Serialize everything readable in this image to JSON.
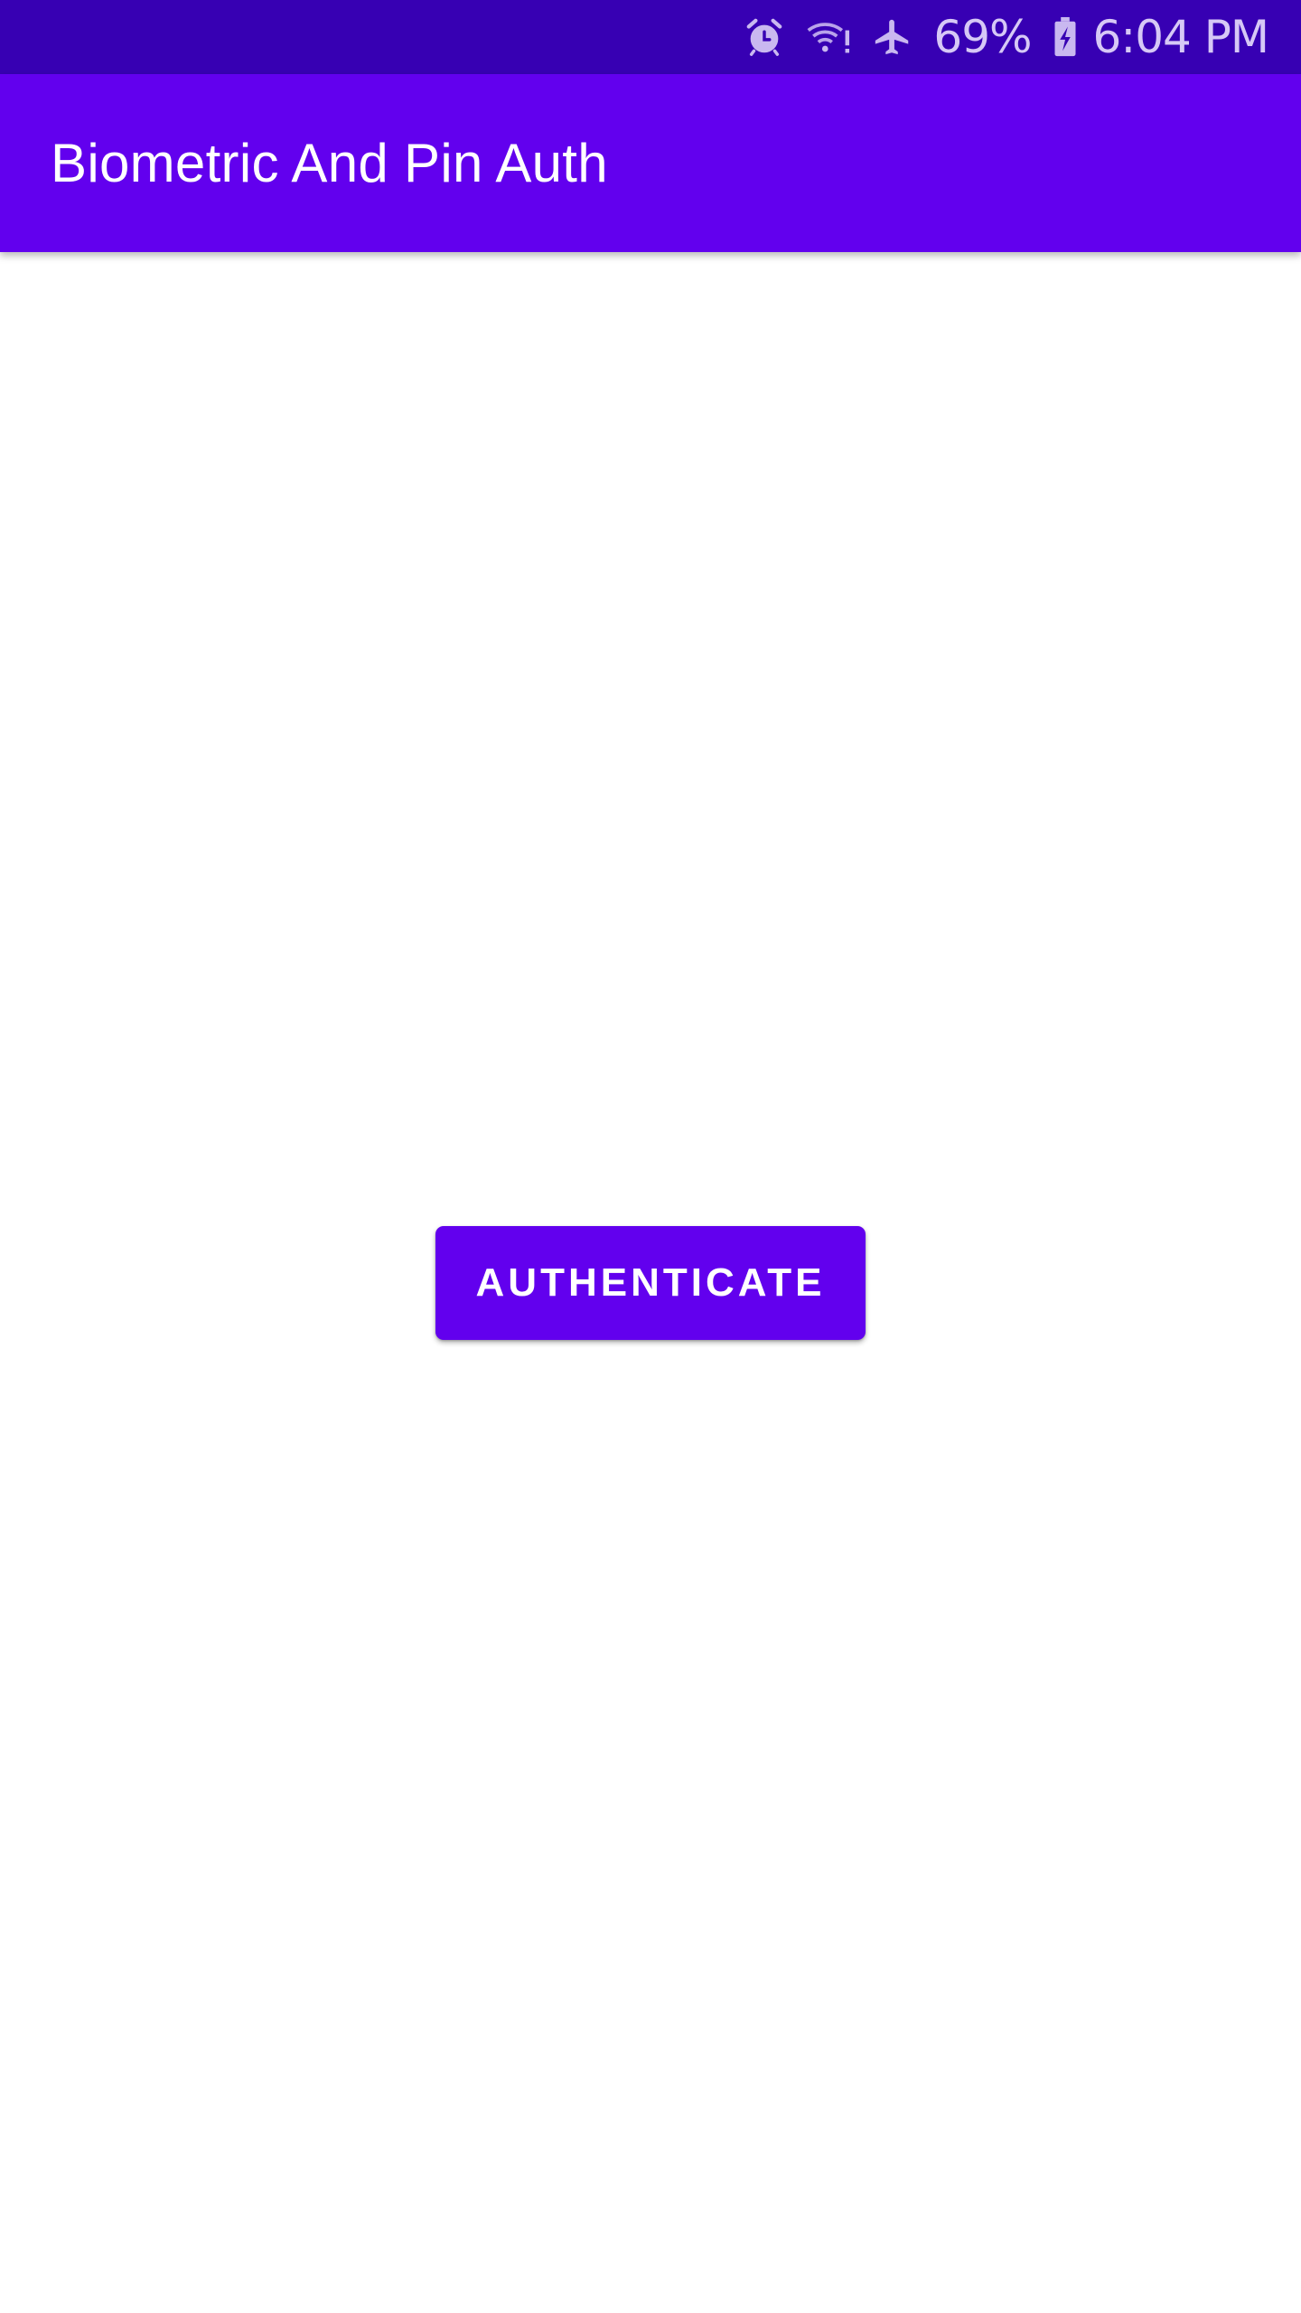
{
  "status_bar": {
    "icons": [
      "alarm-icon",
      "wifi-alert-icon",
      "airplane-mode-icon",
      "battery-charging-icon"
    ],
    "battery": "69%",
    "time": "6:04 PM",
    "background_color": "#3700b3"
  },
  "app_bar": {
    "title": "Biometric And Pin Auth",
    "background_color": "#6200ee"
  },
  "main": {
    "authenticate_label": "AUTHENTICATE",
    "button_color": "#6200ee"
  }
}
